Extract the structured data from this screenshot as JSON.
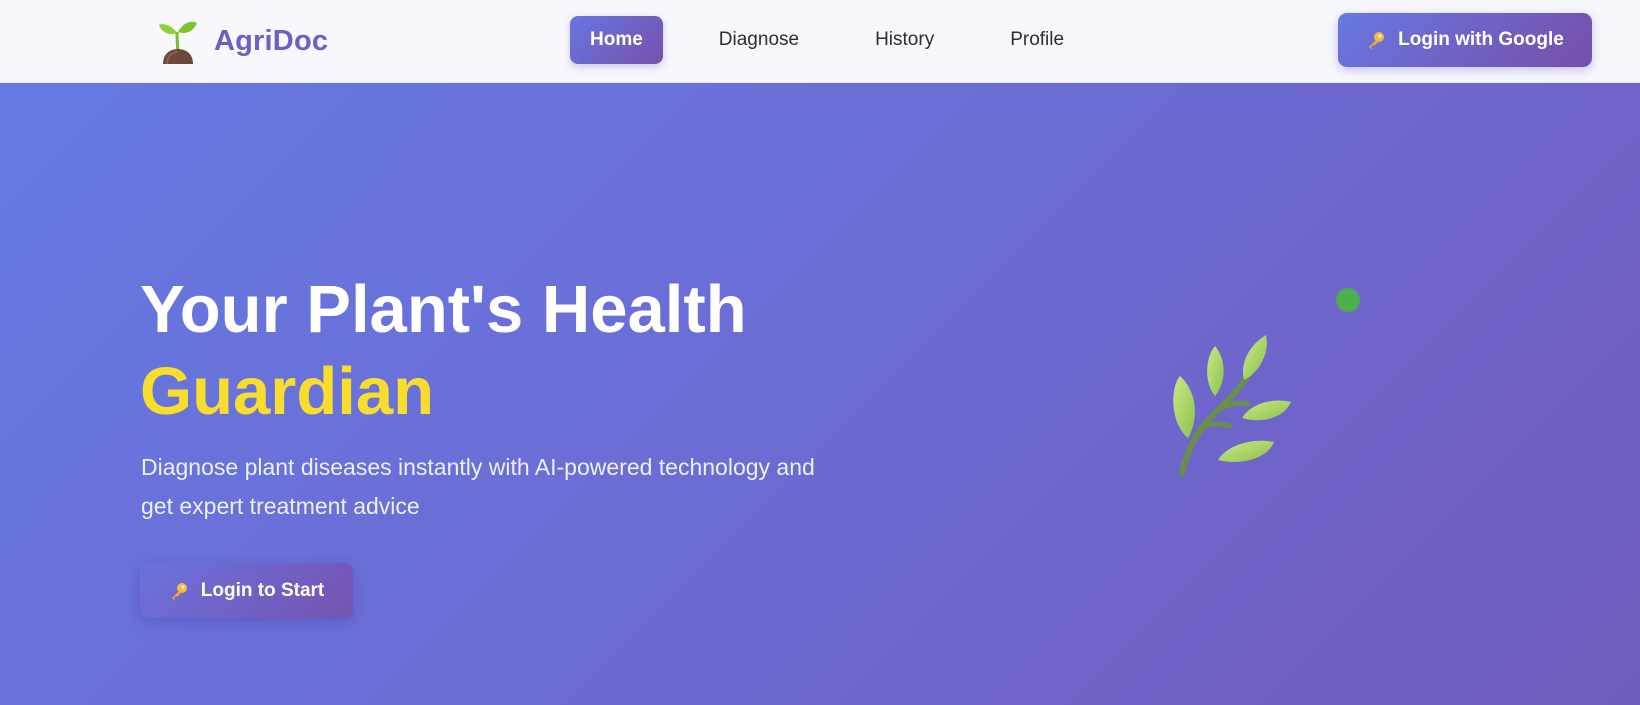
{
  "brand": {
    "name": "AgriDoc",
    "logo_icon": "seedling-icon"
  },
  "nav": {
    "items": [
      {
        "label": "Home",
        "active": true
      },
      {
        "label": "Diagnose",
        "active": false
      },
      {
        "label": "History",
        "active": false
      },
      {
        "label": "Profile",
        "active": false
      }
    ]
  },
  "header": {
    "login_label": "Login with Google",
    "login_icon": "key-icon"
  },
  "hero": {
    "title_line1": "Your Plant's Health",
    "title_line2": "Guardian",
    "subtitle": "Diagnose plant diseases instantly with AI-powered technology and get expert treatment advice",
    "cta_label": "Login to Start",
    "cta_icon": "key-icon",
    "illustration_icon": "herb-icon"
  },
  "colors": {
    "brand": "#6d60c0",
    "accent_yellow": "#f9dd2d",
    "gradient_start": "#6679e3",
    "gradient_end": "#725bbe",
    "dot_green": "#4caf50"
  }
}
